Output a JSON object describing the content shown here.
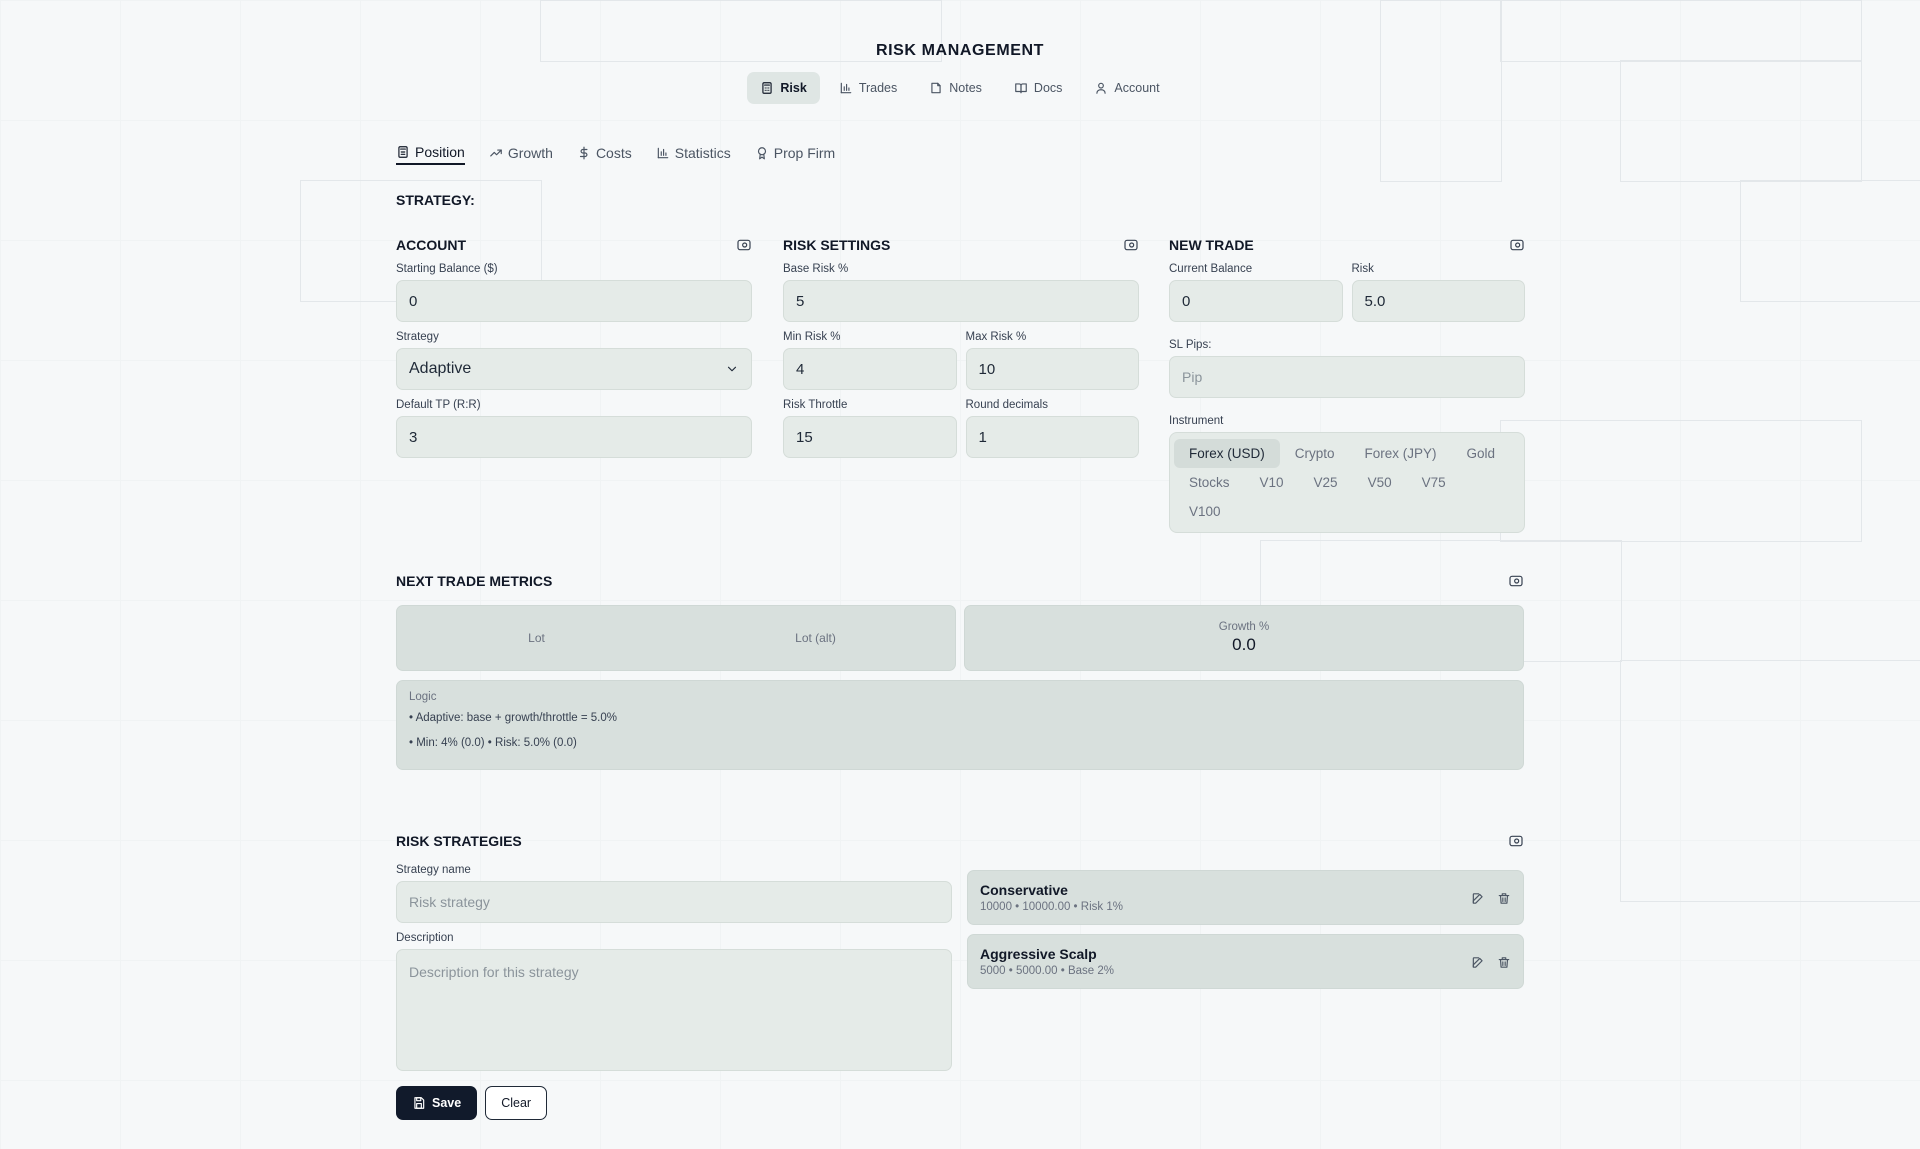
{
  "app_title": "RISK MANAGEMENT",
  "topnav": [
    {
      "label": "Risk",
      "icon": "calculator-icon",
      "active": true
    },
    {
      "label": "Trades",
      "icon": "bar-chart-icon"
    },
    {
      "label": "Notes",
      "icon": "note-icon"
    },
    {
      "label": "Docs",
      "icon": "book-icon"
    },
    {
      "label": "Account",
      "icon": "user-icon"
    }
  ],
  "subtabs": [
    {
      "label": "Position",
      "icon": "calculator-icon",
      "active": true
    },
    {
      "label": "Growth",
      "icon": "trending-up-icon"
    },
    {
      "label": "Costs",
      "icon": "dollar-icon"
    },
    {
      "label": "Statistics",
      "icon": "bar-chart-icon"
    },
    {
      "label": "Prop Firm",
      "icon": "award-icon"
    }
  ],
  "strategy_label": "STRATEGY:",
  "account": {
    "title": "ACCOUNT",
    "starting_balance_label": "Starting Balance ($)",
    "starting_balance_value": "0",
    "strategy_label": "Strategy",
    "strategy_value": "Adaptive",
    "default_tp_label": "Default TP (R:R)",
    "default_tp_value": "3"
  },
  "risk_settings": {
    "title": "RISK SETTINGS",
    "base_risk_label": "Base Risk %",
    "base_risk_value": "5",
    "min_risk_label": "Min Risk %",
    "min_risk_value": "4",
    "max_risk_label": "Max Risk %",
    "max_risk_value": "10",
    "throttle_label": "Risk Throttle",
    "throttle_value": "15",
    "round_label": "Round decimals",
    "round_value": "1"
  },
  "new_trade": {
    "title": "NEW TRADE",
    "current_balance_label": "Current Balance",
    "current_balance_value": "0",
    "risk_label": "Risk",
    "risk_value": "5.0",
    "sl_pips_label": "SL Pips:",
    "sl_pips_placeholder": "Pip",
    "instrument_label": "Instrument",
    "instruments": [
      "Forex (USD)",
      "Crypto",
      "Forex (JPY)",
      "Gold",
      "Stocks",
      "V10",
      "V25",
      "V50",
      "V75",
      "V100"
    ],
    "active_instrument": "Forex (USD)"
  },
  "metrics": {
    "title": "NEXT TRADE METRICS",
    "lot_label": "Lot",
    "lot_alt_label": "Lot (alt)",
    "growth_label": "Growth %",
    "growth_value": "0.0",
    "logic_title": "Logic",
    "logic_line1": "• Adaptive: base + growth/throttle = 5.0%",
    "logic_line2": "• Min: 4% (0.0) • Risk: 5.0% (0.0)"
  },
  "strategies": {
    "title": "RISK STRATEGIES",
    "name_label": "Strategy name",
    "name_placeholder": "Risk strategy",
    "desc_label": "Description",
    "desc_placeholder": "Description for this strategy",
    "save_label": "Save",
    "clear_label": "Clear",
    "items": [
      {
        "name": "Conservative",
        "meta": "10000 • 10000.00 • Risk 1%"
      },
      {
        "name": "Aggressive Scalp",
        "meta": "5000 • 5000.00 • Base 2%"
      }
    ]
  }
}
